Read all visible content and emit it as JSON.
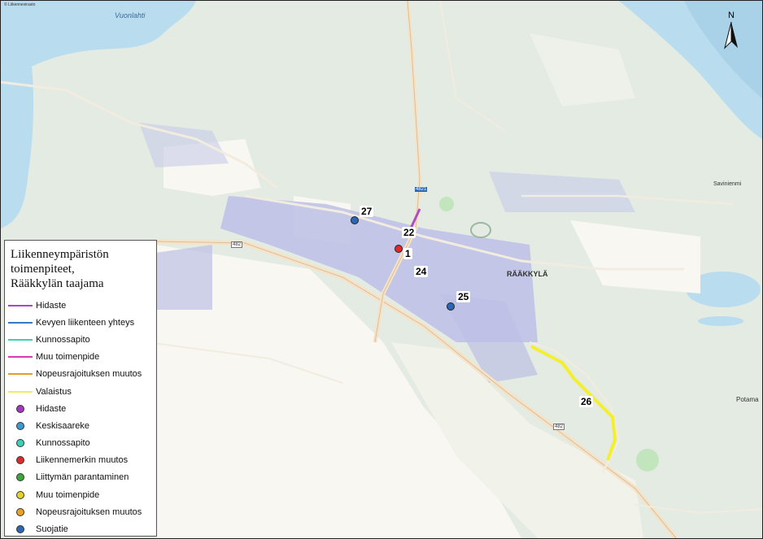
{
  "map": {
    "copyright": "© Liikennevirasto",
    "north_label": "N",
    "place_names": {
      "lake": "Vuonlahti",
      "village": "RÄÄKKYLÄ",
      "savinienmi": "Savinienmi",
      "potama": "Potama"
    },
    "road_numbers": [
      "482",
      "482",
      "4821"
    ],
    "colors": {
      "land": "#e3ebe2",
      "water": "#b9dcef",
      "field": "#f8f7f2",
      "road": "#f6e3c7",
      "built": "#bdc0e6",
      "lila": "#b04cc4",
      "valaistus": "#f4ef2e"
    }
  },
  "markers": [
    {
      "number": "27",
      "color": "#2c67b7"
    },
    {
      "number": "22",
      "color": "#b04cc4"
    },
    {
      "number": "1",
      "color": "#e0292b"
    },
    {
      "number": "24",
      "color": ""
    },
    {
      "number": "25",
      "color": "#2c67b7"
    },
    {
      "number": "26",
      "color": "#f4ef2e"
    }
  ],
  "legend": {
    "title_lines": [
      "Liikenneympäristön",
      "toimenpiteet,",
      "Rääkkylän taajama"
    ],
    "items": [
      {
        "label": "Hidaste",
        "kind": "line",
        "color": "#a348c4"
      },
      {
        "label": "Kevyen liikenteen yhteys",
        "kind": "line",
        "color": "#3578c6"
      },
      {
        "label": "Kunnossapito",
        "kind": "line",
        "color": "#3ad1b4"
      },
      {
        "label": "Muu toimenpide",
        "kind": "line",
        "color": "#d63bb3"
      },
      {
        "label": "Nopeusrajoituksen muutos",
        "kind": "line",
        "color": "#e49b28"
      },
      {
        "label": "Valaistus",
        "kind": "line",
        "color": "#f3ec5a"
      },
      {
        "label": "Hidaste",
        "kind": "dot",
        "color": "#a735c4"
      },
      {
        "label": "Keskisaareke",
        "kind": "dot",
        "color": "#3c9ad3"
      },
      {
        "label": "Kunnossapito",
        "kind": "dot",
        "color": "#3ad1b4"
      },
      {
        "label": "Liikennemerkin muutos",
        "kind": "dot",
        "color": "#e0292b"
      },
      {
        "label": "Liittymän parantaminen",
        "kind": "dot",
        "color": "#3aa838"
      },
      {
        "label": "Muu toimenpide",
        "kind": "dot",
        "color": "#e0d42a"
      },
      {
        "label": "Nopeusrajoituksen muutos",
        "kind": "dot",
        "color": "#eaa124"
      },
      {
        "label": "Suojatie",
        "kind": "dot",
        "color": "#2c67b7"
      }
    ]
  }
}
